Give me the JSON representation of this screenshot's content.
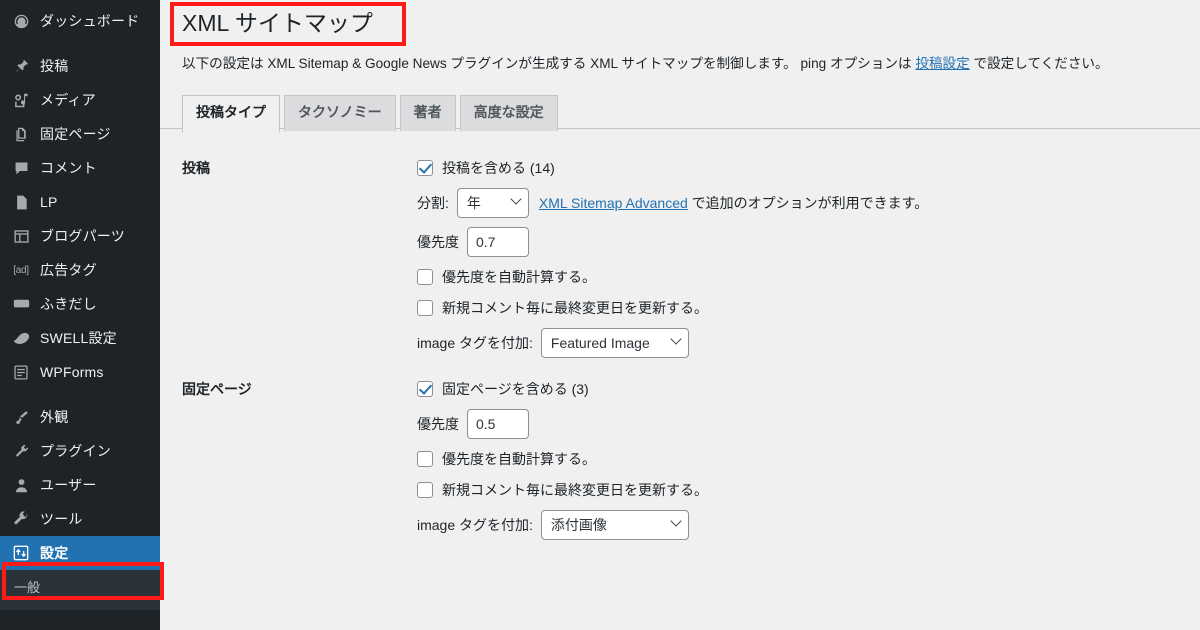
{
  "sidebar": {
    "items": [
      {
        "label": "ダッシュボード",
        "icon": "dashboard-icon",
        "group": 0
      },
      {
        "label": "投稿",
        "icon": "pin-icon",
        "group": 1
      },
      {
        "label": "メディア",
        "icon": "media-icon",
        "group": 1
      },
      {
        "label": "固定ページ",
        "icon": "pages-icon",
        "group": 1
      },
      {
        "label": "コメント",
        "icon": "comment-icon",
        "group": 1
      },
      {
        "label": "LP",
        "icon": "page-icon",
        "group": 1
      },
      {
        "label": "ブログパーツ",
        "icon": "blocks-icon",
        "group": 1
      },
      {
        "label": "広告タグ",
        "icon": "ad-icon",
        "group": 1
      },
      {
        "label": "ふきだし",
        "icon": "balloon-icon",
        "group": 1
      },
      {
        "label": "SWELL設定",
        "icon": "swell-icon",
        "group": 1
      },
      {
        "label": "WPForms",
        "icon": "forms-icon",
        "group": 1
      },
      {
        "label": "外観",
        "icon": "brush-icon",
        "group": 2
      },
      {
        "label": "プラグイン",
        "icon": "plugin-icon",
        "group": 2
      },
      {
        "label": "ユーザー",
        "icon": "user-icon",
        "group": 2
      },
      {
        "label": "ツール",
        "icon": "wrench-icon",
        "group": 2
      },
      {
        "label": "設定",
        "icon": "settings-icon",
        "group": 2,
        "current": true
      }
    ],
    "submenu": [
      {
        "label": "一般"
      }
    ],
    "colors": {
      "background": "#1d2327",
      "current_background": "#2271b1",
      "submenu_background": "#2c3338",
      "text": "#f0f0f1"
    }
  },
  "annotations": {
    "highlight_color": "#ff1a1a",
    "title_box": "XML サイトマップ",
    "settings_box": "設定"
  },
  "main": {
    "page_title": "XML サイトマップ",
    "description": {
      "part1": "以下の設定は XML Sitemap & Google News プラグインが生成する XML サイトマップを制御します。 ping オプションは ",
      "link": "投稿設定",
      "part2": " で設定してください。"
    },
    "tabs": [
      {
        "label": "投稿タイプ",
        "active": true
      },
      {
        "label": "タクソノミー",
        "active": false
      },
      {
        "label": "著者",
        "active": false
      },
      {
        "label": "高度な設定",
        "active": false
      }
    ],
    "sections": [
      {
        "heading": "投稿",
        "include_label": "投稿を含める (14)",
        "include_checked": true,
        "split_label": "分割:",
        "split_value": "年",
        "advanced_link": "XML Sitemap Advanced",
        "advanced_note": " で追加のオプションが利用できます。",
        "priority_label": "優先度",
        "priority_value": "0.7",
        "auto_priority_label": "優先度を自動計算する。",
        "auto_priority_checked": false,
        "update_lastmod_label": "新規コメント毎に最終変更日を更新する。",
        "update_lastmod_checked": false,
        "image_tag_label": "image タグを付加:",
        "image_tag_value": "Featured Image"
      },
      {
        "heading": "固定ページ",
        "include_label": "固定ページを含める (3)",
        "include_checked": true,
        "priority_label": "優先度",
        "priority_value": "0.5",
        "auto_priority_label": "優先度を自動計算する。",
        "auto_priority_checked": false,
        "update_lastmod_label": "新規コメント毎に最終変更日を更新する。",
        "update_lastmod_checked": false,
        "image_tag_label": "image タグを付加:",
        "image_tag_value": "添付画像"
      }
    ]
  }
}
